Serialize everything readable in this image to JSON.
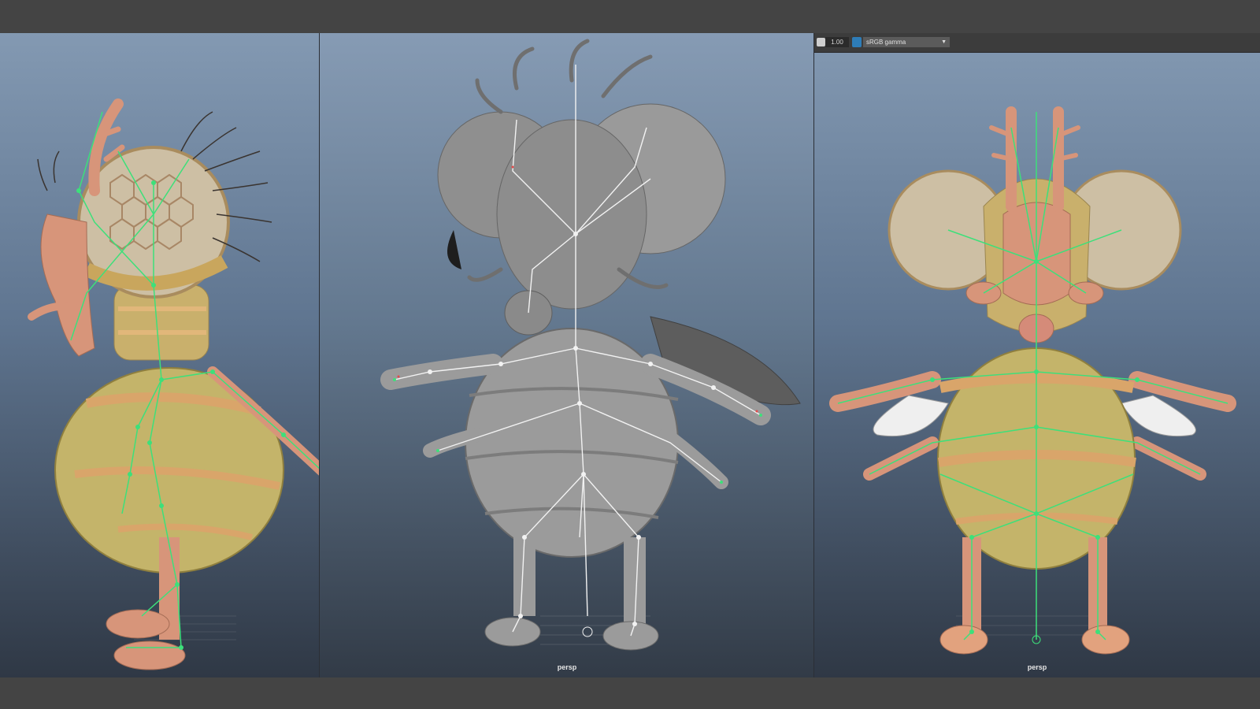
{
  "viewports": {
    "left": {
      "label": ""
    },
    "center": {
      "label": "persp"
    },
    "right": {
      "label": "persp"
    }
  },
  "viewport_toolbar": {
    "gamma_value": "1.00",
    "color_space": "sRGB gamma",
    "icons": [
      "exposure-icon",
      "color-management-icon",
      "chevron-down-icon"
    ]
  },
  "colors": {
    "joint_green": "#3de07a",
    "joint_white": "#f2f2f2",
    "body_yellow": "#c4b46a",
    "skin_orange": "#d7957a",
    "gray_model": "#9b9b9b"
  }
}
